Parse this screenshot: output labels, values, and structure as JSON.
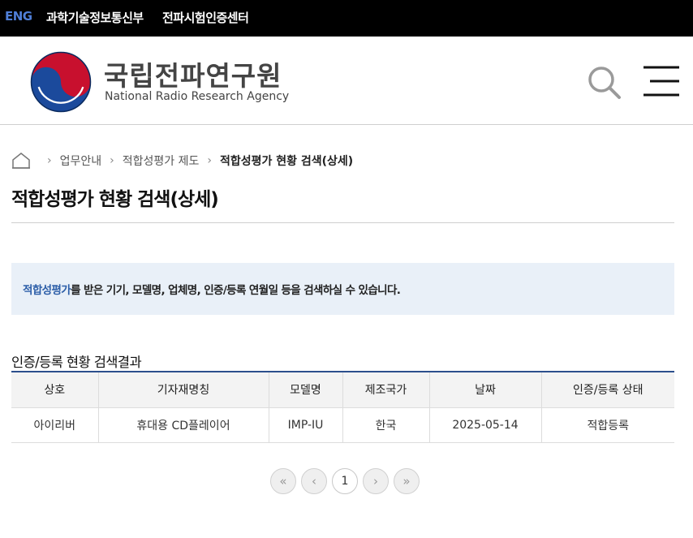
{
  "topbar": {
    "eng": "ENG",
    "link1": "과학기술정보통신부",
    "link2": "전파시험인증센터"
  },
  "header": {
    "logo_ko": "국립전파연구원",
    "logo_en": "National Radio Research Agency",
    "logo_colors": {
      "red": "#c8102e",
      "blue": "#1b4a9c",
      "dark": "#0a2a5e"
    }
  },
  "breadcrumb": {
    "items": [
      "업무안내",
      "적합성평가 제도",
      "적합성평가 현황 검색(상세)"
    ]
  },
  "page_title": "적합성평가 현황 검색(상세)",
  "info": {
    "highlight": "적합성평가",
    "text": "를 받은 기기, 모델명, 업체명, 인증/등록 연월일 등을 검색하실 수 있습니다."
  },
  "result": {
    "title": "인증/등록 현황 검색결과",
    "columns": [
      "상호",
      "기자재명칭",
      "모델명",
      "제조국가",
      "날짜",
      "인증/등록 상태"
    ],
    "rows": [
      [
        "아이리버",
        "휴대용 CD플레이어",
        "IMP-IU",
        "한국",
        "2025-05-14",
        "적합등록"
      ]
    ]
  },
  "pagination": {
    "first": "«",
    "prev": "‹",
    "current": "1",
    "next": "›",
    "last": "»"
  },
  "colors": {
    "accent": "#2c5ea8",
    "table_border": "#2c4f8c",
    "info_bg": "#e9f0f8"
  }
}
